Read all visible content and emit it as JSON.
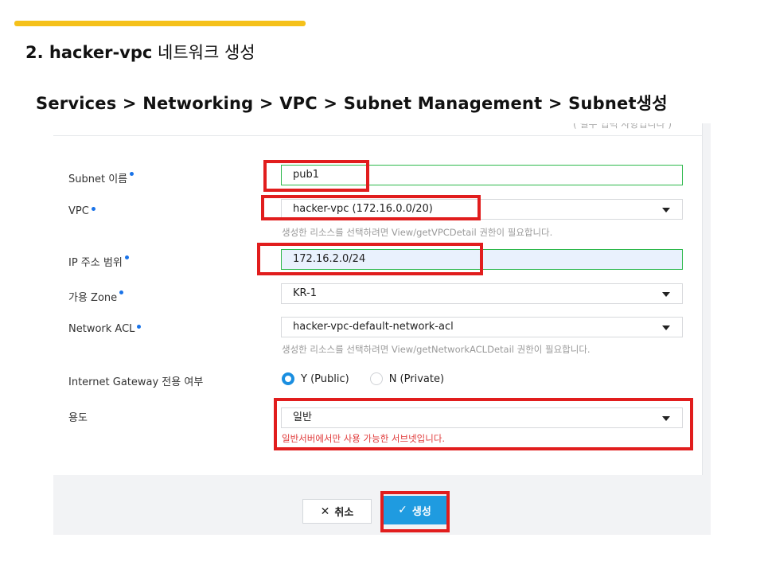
{
  "slide": {
    "title_prefix": "2. hacker-vpc",
    "title_suffix": " 네트워크 생성",
    "breadcrumb": "Services > Networking > VPC  > Subnet Management > Subnet생성",
    "accent_color": "#f5c11a"
  },
  "form": {
    "top_note": "( 필수 입력 사항입니다 )",
    "subnet_name": {
      "label": "Subnet 이름",
      "value": "pub1"
    },
    "vpc": {
      "label": "VPC",
      "value": "hacker-vpc (172.16.0.0/20)",
      "hint": "생성한 리소스를 선택하려면 View/getVPCDetail 권한이 필요합니다."
    },
    "ip_range": {
      "label": "IP 주소 범위",
      "value": "172.16.2.0/24"
    },
    "zone": {
      "label": "가용 Zone",
      "value": "KR-1"
    },
    "network_acl": {
      "label": "Network ACL",
      "value": "hacker-vpc-default-network-acl",
      "hint": "생성한 리소스를 선택하려면 View/getNetworkACLDetail 권한이 필요합니다."
    },
    "igw": {
      "label": "Internet Gateway 전용 여부",
      "options": [
        "Y (Public)",
        "N (Private)"
      ],
      "selected": "Y (Public)"
    },
    "usage": {
      "label": "용도",
      "value": "일반",
      "hint": "일반서버에서만 사용 가능한 서브넷입니다."
    }
  },
  "buttons": {
    "cancel": "취소",
    "create": "생성",
    "cancel_icon": "close-icon",
    "create_icon": "check-icon"
  },
  "colors": {
    "highlight": "#e11d1d",
    "primary": "#1f9be0",
    "valid_border": "#2db84c"
  }
}
